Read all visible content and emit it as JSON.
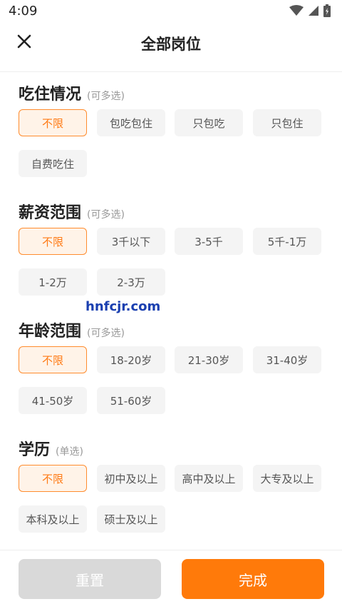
{
  "status_bar": {
    "time": "4:09",
    "icons": [
      "wifi-icon",
      "signal-icon",
      "battery-icon"
    ]
  },
  "header": {
    "close_icon": "close-icon",
    "title": "全部岗位"
  },
  "sections": {
    "food_housing": {
      "title": "吃住情况",
      "hint": "(可多选)",
      "options": [
        "不限",
        "包吃包住",
        "只包吃",
        "只包住",
        "自费吃住"
      ],
      "selected": "不限"
    },
    "salary": {
      "title": "薪资范围",
      "hint": "(可多选)",
      "options": [
        "不限",
        "3千以下",
        "3-5千",
        "5千-1万",
        "1-2万",
        "2-3万"
      ],
      "selected": "不限"
    },
    "age": {
      "title": "年龄范围",
      "hint": "(可多选)",
      "options": [
        "不限",
        "18-20岁",
        "21-30岁",
        "31-40岁",
        "41-50岁",
        "51-60岁"
      ],
      "selected": "不限"
    },
    "education": {
      "title": "学历",
      "hint": "(单选)",
      "options": [
        "不限",
        "初中及以上",
        "高中及以上",
        "大专及以上",
        "本科及以上",
        "硕士及以上"
      ],
      "selected": "不限"
    }
  },
  "watermark": "hnfcjr.com",
  "footer": {
    "reset_label": "重置",
    "done_label": "完成"
  },
  "colors": {
    "accent": "#ff7a0a",
    "selected_bg": "#fff3e8",
    "chip_bg": "#f4f4f4",
    "reset_bg": "#d9d9d9"
  }
}
